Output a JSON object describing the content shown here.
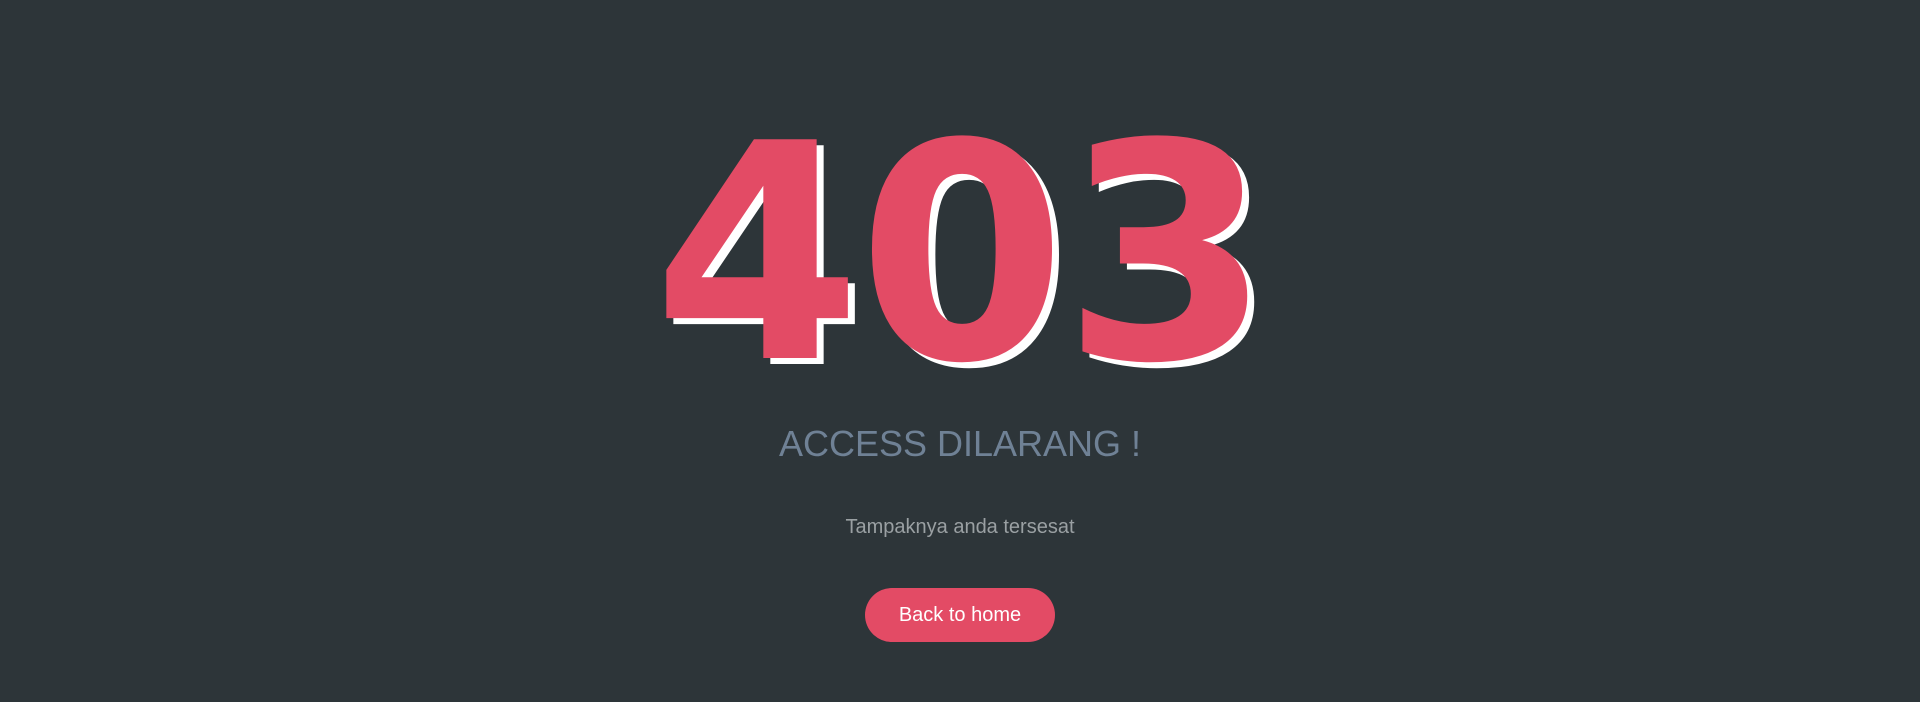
{
  "error": {
    "code": "403",
    "title": "ACCESS DILARANG !",
    "message": "Tampaknya anda tersesat"
  },
  "actions": {
    "back_home_label": "Back to home"
  },
  "colors": {
    "background": "#2d3539",
    "accent": "#e34b65",
    "code_shadow": "#ffffff",
    "title": "#6f8195",
    "message": "#9aa0a3"
  }
}
